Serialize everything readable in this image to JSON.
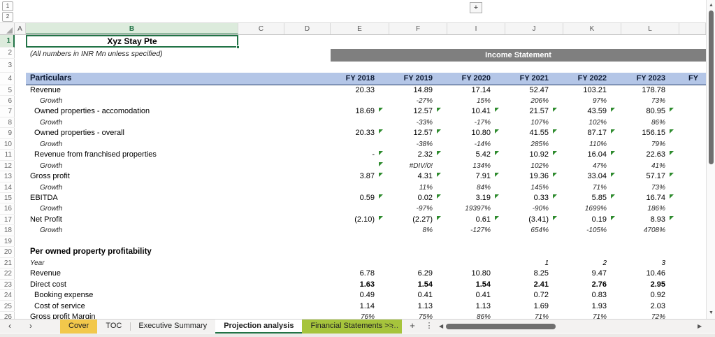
{
  "outline": {
    "level1": "1",
    "level2": "2",
    "expand": "+"
  },
  "columns": [
    "A",
    "B",
    "C",
    "D",
    "E",
    "F",
    "I",
    "J",
    "K",
    "L",
    ""
  ],
  "selected_column": "B",
  "selected_row": 1,
  "row_count": 26,
  "title": "Xyz Stay Pte",
  "subtitle": "(All numbers in INR Mn unless specified)",
  "banner": "Income Statement",
  "table_header": {
    "particulars": "Particulars",
    "years": [
      "FY 2018",
      "FY 2019",
      "FY 2020",
      "FY 2021",
      "FY 2022",
      "FY 2023"
    ],
    "partial_year": "FY"
  },
  "rows": [
    {
      "n": 5,
      "label": "Revenue",
      "indent": 0,
      "labelStyle": "normal",
      "valStyle": "num",
      "values": [
        "20.33",
        "14.89",
        "17.14",
        "52.47",
        "103.21",
        "178.78"
      ],
      "flags": [
        0,
        0,
        0,
        0,
        0,
        0
      ]
    },
    {
      "n": 6,
      "label": "Growth",
      "indent": 2,
      "labelStyle": "italic",
      "valStyle": "growth",
      "values": [
        "",
        "-27%",
        "15%",
        "206%",
        "97%",
        "73%"
      ],
      "flags": [
        0,
        0,
        0,
        0,
        0,
        0
      ]
    },
    {
      "n": 7,
      "label": "Owned properties - accomodation",
      "indent": 1,
      "labelStyle": "normal",
      "valStyle": "num",
      "values": [
        "18.69",
        "12.57",
        "10.41",
        "21.57",
        "43.59",
        "80.95"
      ],
      "flags": [
        1,
        1,
        1,
        1,
        1,
        1
      ]
    },
    {
      "n": 8,
      "label": "Growth",
      "indent": 2,
      "labelStyle": "italic",
      "valStyle": "growth",
      "values": [
        "",
        "-33%",
        "-17%",
        "107%",
        "102%",
        "86%"
      ],
      "flags": [
        0,
        0,
        0,
        0,
        0,
        0
      ]
    },
    {
      "n": 9,
      "label": "Owned properties - overall",
      "indent": 1,
      "labelStyle": "normal",
      "valStyle": "num",
      "values": [
        "20.33",
        "12.57",
        "10.80",
        "41.55",
        "87.17",
        "156.15"
      ],
      "flags": [
        1,
        1,
        1,
        1,
        1,
        1
      ]
    },
    {
      "n": 10,
      "label": "Growth",
      "indent": 2,
      "labelStyle": "italic",
      "valStyle": "growth",
      "values": [
        "",
        "-38%",
        "-14%",
        "285%",
        "110%",
        "79%"
      ],
      "flags": [
        0,
        0,
        0,
        0,
        0,
        0
      ]
    },
    {
      "n": 11,
      "label": "Revenue from franchised properties",
      "indent": 1,
      "labelStyle": "normal",
      "valStyle": "num",
      "values": [
        "-",
        "2.32",
        "5.42",
        "10.92",
        "16.04",
        "22.63"
      ],
      "flags": [
        1,
        1,
        1,
        1,
        1,
        1
      ]
    },
    {
      "n": 12,
      "label": "Growth",
      "indent": 2,
      "labelStyle": "italic",
      "valStyle": "growth",
      "values": [
        "",
        "#DIV/0!",
        "134%",
        "102%",
        "47%",
        "41%"
      ],
      "flags": [
        1,
        0,
        0,
        0,
        0,
        0
      ]
    },
    {
      "n": 13,
      "label": "Gross profit",
      "indent": 0,
      "labelStyle": "normal",
      "valStyle": "num",
      "values": [
        "3.87",
        "4.31",
        "7.91",
        "19.36",
        "33.04",
        "57.17"
      ],
      "flags": [
        1,
        1,
        1,
        1,
        1,
        1
      ]
    },
    {
      "n": 14,
      "label": "Growth",
      "indent": 2,
      "labelStyle": "italic",
      "valStyle": "growth",
      "values": [
        "",
        "11%",
        "84%",
        "145%",
        "71%",
        "73%"
      ],
      "flags": [
        0,
        0,
        0,
        0,
        0,
        0
      ]
    },
    {
      "n": 15,
      "label": "EBITDA",
      "indent": 0,
      "labelStyle": "normal",
      "valStyle": "num",
      "values": [
        "0.59",
        "0.02",
        "3.19",
        "0.33",
        "5.85",
        "16.74"
      ],
      "flags": [
        1,
        1,
        1,
        1,
        1,
        1
      ]
    },
    {
      "n": 16,
      "label": "Growth",
      "indent": 2,
      "labelStyle": "italic",
      "valStyle": "growth",
      "values": [
        "",
        "-97%",
        "19397%",
        "-90%",
        "1699%",
        "186%"
      ],
      "flags": [
        0,
        0,
        0,
        0,
        0,
        0
      ]
    },
    {
      "n": 17,
      "label": "Net Profit",
      "indent": 0,
      "labelStyle": "normal",
      "valStyle": "num",
      "values": [
        "(2.10)",
        "(2.27)",
        "0.61",
        "(3.41)",
        "0.19",
        "8.93"
      ],
      "flags": [
        1,
        1,
        1,
        1,
        1,
        1
      ]
    },
    {
      "n": 18,
      "label": "Growth",
      "indent": 2,
      "labelStyle": "italic",
      "valStyle": "growth",
      "values": [
        "",
        "8%",
        "-127%",
        "654%",
        "-105%",
        "4708%"
      ],
      "flags": [
        0,
        0,
        0,
        0,
        0,
        0
      ]
    },
    {
      "n": 19,
      "label": "",
      "indent": 0,
      "labelStyle": "normal",
      "valStyle": "num",
      "values": [
        "",
        "",
        "",
        "",
        "",
        ""
      ],
      "flags": [
        0,
        0,
        0,
        0,
        0,
        0
      ]
    },
    {
      "n": 20,
      "label": "Per owned property profitability",
      "indent": 0,
      "labelStyle": "bold",
      "valStyle": "num",
      "values": [
        "",
        "",
        "",
        "",
        "",
        ""
      ],
      "flags": [
        0,
        0,
        0,
        0,
        0,
        0
      ]
    },
    {
      "n": 21,
      "label": "Year",
      "indent": 0,
      "labelStyle": "italic",
      "valStyle": "yearit",
      "values": [
        "",
        "",
        "",
        "1",
        "2",
        "3"
      ],
      "flags": [
        0,
        0,
        0,
        0,
        0,
        0
      ]
    },
    {
      "n": 22,
      "label": "Revenue",
      "indent": 0,
      "labelStyle": "normal",
      "valStyle": "num",
      "values": [
        "6.78",
        "6.29",
        "10.80",
        "8.25",
        "9.47",
        "10.46"
      ],
      "flags": [
        0,
        0,
        0,
        0,
        0,
        0
      ]
    },
    {
      "n": 23,
      "label": "Direct cost",
      "indent": 0,
      "labelStyle": "normal",
      "valStyle": "boldnum",
      "values": [
        "1.63",
        "1.54",
        "1.54",
        "2.41",
        "2.76",
        "2.95"
      ],
      "flags": [
        0,
        0,
        0,
        0,
        0,
        0
      ]
    },
    {
      "n": 24,
      "label": "Booking expense",
      "indent": 1,
      "labelStyle": "normal",
      "valStyle": "num",
      "values": [
        "0.49",
        "0.41",
        "0.41",
        "0.72",
        "0.83",
        "0.92"
      ],
      "flags": [
        0,
        0,
        0,
        0,
        0,
        0
      ]
    },
    {
      "n": 25,
      "label": "Cost of service",
      "indent": 1,
      "labelStyle": "normal",
      "valStyle": "num",
      "values": [
        "1.14",
        "1.13",
        "1.13",
        "1.69",
        "1.93",
        "2.03"
      ],
      "flags": [
        0,
        0,
        0,
        0,
        0,
        0
      ]
    },
    {
      "n": 26,
      "label": "Gross profit Margin",
      "indent": 0,
      "labelStyle": "normal",
      "valStyle": "growth",
      "values": [
        "76%",
        "75%",
        "86%",
        "71%",
        "71%",
        "72%"
      ],
      "flags": [
        0,
        0,
        0,
        0,
        0,
        0
      ]
    }
  ],
  "tab_bar": {
    "nav_left": "‹",
    "nav_right": "›",
    "tabs": [
      {
        "label": "Cover",
        "bg": "#f2c84b",
        "active": false
      },
      {
        "label": "TOC",
        "bg": "",
        "active": false
      },
      {
        "label": "Executive Summary",
        "bg": "",
        "active": false
      },
      {
        "label": "Projection analysis",
        "bg": "",
        "active": true
      },
      {
        "label": "Financial Statements >>",
        "bg": "#a6c43c",
        "active": false
      }
    ],
    "more": "…",
    "add": "+",
    "menu": "⋮"
  },
  "scrollbars": {
    "up": "▲",
    "down": "▼",
    "left": "◀",
    "right": "▶"
  },
  "colors": {
    "accent_green": "#217346",
    "header_band": "#b4c6e7",
    "banner_gray": "#7f7f7f",
    "flag_green": "#2e8b2e"
  }
}
